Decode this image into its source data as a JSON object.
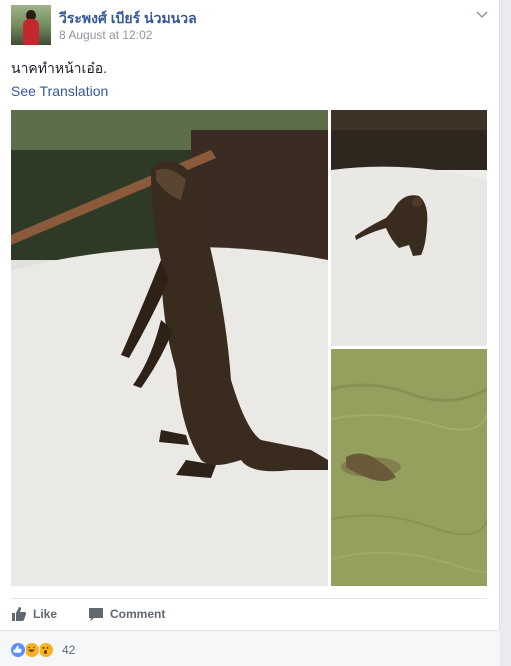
{
  "post": {
    "author": "วีระพงศ์ เบียร์ น่วมนวล",
    "timestamp": "8 August at 12:02",
    "text": "นาคทำหน้าเอ๋อ.",
    "translate_label": "See Translation"
  },
  "photos": [
    {
      "name": "otter-standing-on-rice"
    },
    {
      "name": "otter-walking-on-rice"
    },
    {
      "name": "otter-swimming-in-water"
    }
  ],
  "actions": {
    "like_label": "Like",
    "comment_label": "Comment"
  },
  "reactions": {
    "icons": [
      "like-icon",
      "haha-icon",
      "wow-icon"
    ],
    "count": "42"
  },
  "colors": {
    "link": "#365899",
    "muted": "#90949c",
    "like_blue": "#5890ff",
    "emoji_yellow": "#f7b125"
  }
}
